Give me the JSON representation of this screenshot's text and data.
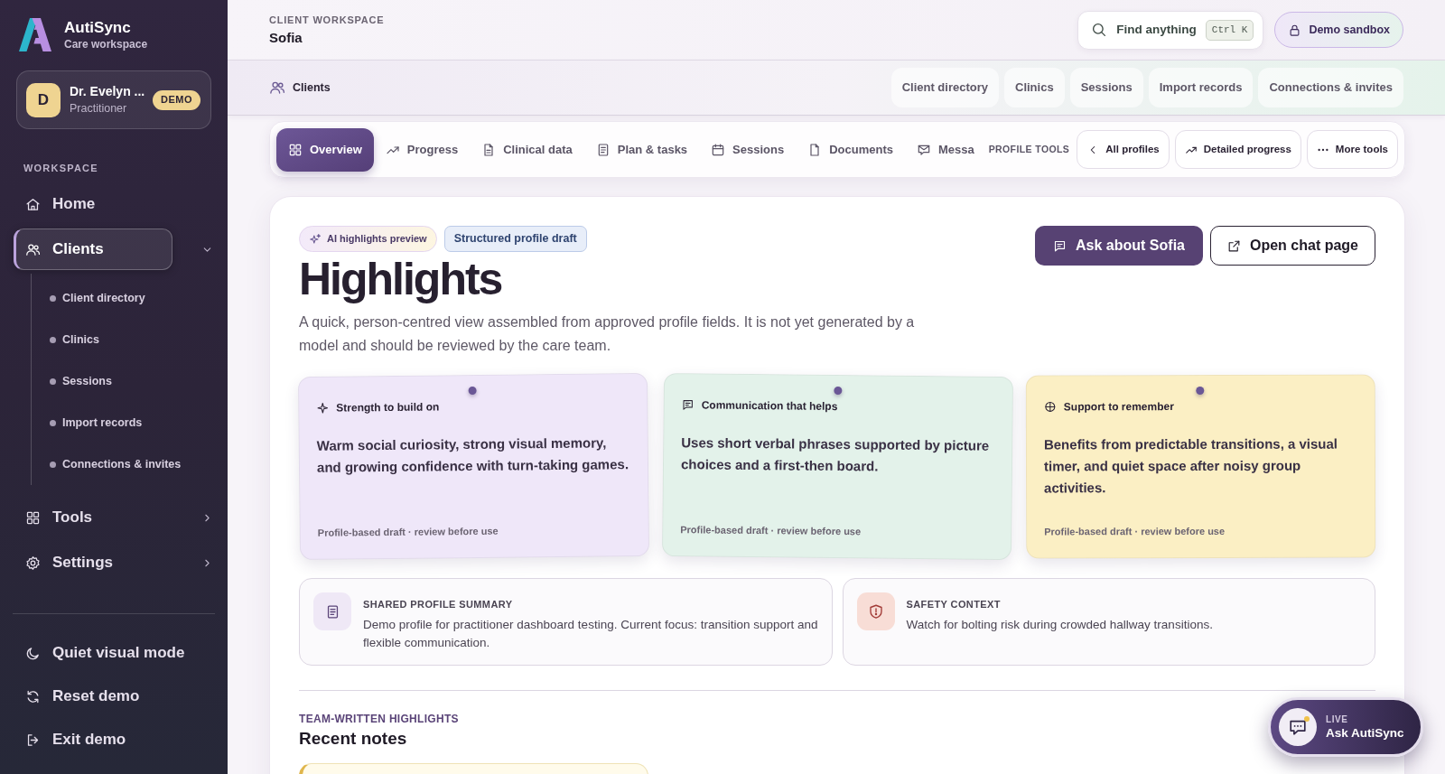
{
  "sidebar": {
    "brand": {
      "name": "AutiSync",
      "tagline": "Care workspace"
    },
    "user": {
      "initial": "D",
      "name": "Dr. Evelyn ...",
      "role": "Practitioner",
      "badge": "DEMO"
    },
    "section_label": "WORKSPACE",
    "nav": [
      {
        "label": "Home",
        "kind": "link",
        "selected": false
      },
      {
        "label": "Clients",
        "kind": "group",
        "selected": true,
        "expanded": true,
        "children": [
          {
            "label": "Client directory",
            "selected": false
          },
          {
            "label": "Clinics",
            "selected": false
          },
          {
            "label": "Sessions",
            "selected": false
          },
          {
            "label": "Import records",
            "selected": false
          },
          {
            "label": "Connections & invites",
            "selected": false
          }
        ]
      },
      {
        "label": "Tools",
        "kind": "group",
        "selected": false,
        "expanded": false
      },
      {
        "label": "Settings",
        "kind": "group",
        "selected": false,
        "expanded": false
      }
    ],
    "actions": [
      "Quiet visual mode",
      "Reset demo",
      "Exit demo"
    ]
  },
  "header": {
    "eyebrow": "CLIENT WORKSPACE",
    "title": "Sofia",
    "search": {
      "label": "Find anything",
      "shortcut": "Ctrl K"
    },
    "sandbox": "Demo sandbox"
  },
  "subnav": {
    "section": "Clients",
    "links": [
      "Client directory",
      "Clinics",
      "Sessions",
      "Import records",
      "Connections & invites"
    ]
  },
  "tabs": [
    {
      "label": "Overview",
      "selected": true
    },
    {
      "label": "Progress",
      "selected": false
    },
    {
      "label": "Clinical data",
      "selected": false
    },
    {
      "label": "Plan & tasks",
      "selected": false
    },
    {
      "label": "Sessions",
      "selected": false
    },
    {
      "label": "Documents",
      "selected": false
    },
    {
      "label": "Messa",
      "selected": false
    }
  ],
  "profile_tools": {
    "label": "PROFILE TOOLS",
    "buttons": [
      "All profiles",
      "Detailed progress",
      "More tools"
    ]
  },
  "highlights": {
    "badges": [
      {
        "label": "AI highlights preview",
        "kind": "ai"
      },
      {
        "label": "Structured profile draft",
        "kind": "draft"
      }
    ],
    "title": "Highlights",
    "description": "A quick, person-centred view assembled from approved profile fields. It is not yet generated by a model and should be reviewed by the care team.",
    "actions": [
      {
        "label": "Ask about Sofia",
        "kind": "primary"
      },
      {
        "label": "Open chat page",
        "kind": "secondary"
      }
    ],
    "cards": [
      {
        "title": "Strength to build on",
        "body": "Warm social curiosity, strong visual memory, and growing confidence with turn-taking games.",
        "footer": "Profile-based draft · review before use",
        "color": "#efe7f9"
      },
      {
        "title": "Communication that helps",
        "body": "Uses short verbal phrases supported by picture choices and a first-then board.",
        "footer": "Profile-based draft · review before use",
        "color": "#e3f2ea"
      },
      {
        "title": "Support to remember",
        "body": "Benefits from predictable transitions, a visual timer, and quiet space after noisy group activities.",
        "footer": "Profile-based draft · review before use",
        "color": "#fbefc4"
      }
    ],
    "summaries": [
      {
        "kind": "summary",
        "title": "SHARED PROFILE SUMMARY",
        "text": "Demo profile for practitioner dashboard testing. Current focus: transition support and flexible communication."
      },
      {
        "kind": "safety",
        "title": "SAFETY CONTEXT",
        "text": "Watch for bolting risk during crowded hallway transitions."
      }
    ],
    "notes": {
      "eyebrow": "TEAM-WRITTEN HIGHLIGHTS",
      "title": "Recent notes"
    }
  },
  "chat_launcher": {
    "status": "LIVE",
    "label": "Ask AutiSync"
  }
}
